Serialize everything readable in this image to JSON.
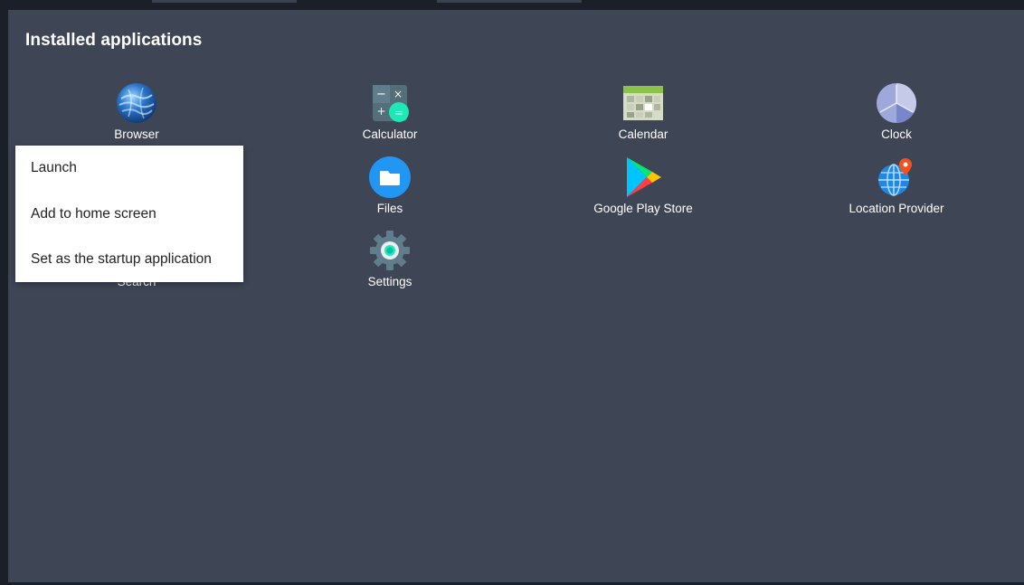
{
  "header": {
    "title": "Installed applications"
  },
  "apps": [
    {
      "label": "Browser",
      "icon": "browser-globe-icon"
    },
    {
      "label": "Calculator",
      "icon": "calculator-icon"
    },
    {
      "label": "Calendar",
      "icon": "calendar-icon"
    },
    {
      "label": "Clock",
      "icon": "clock-icon"
    },
    {
      "label": "Files",
      "icon": "folder-icon"
    },
    {
      "label": "Google Play Store",
      "icon": "play-store-icon"
    },
    {
      "label": "Location Provider",
      "icon": "location-globe-icon"
    },
    {
      "label": "Search",
      "icon": "search-icon"
    },
    {
      "label": "Settings",
      "icon": "gear-icon"
    }
  ],
  "context_menu": {
    "items": [
      {
        "label": "Launch"
      },
      {
        "label": "Add to home screen"
      },
      {
        "label": "Set as the startup application"
      }
    ]
  },
  "colors": {
    "screen_background": "#3e4555",
    "frame": "#1b1f28",
    "menu_background": "#ffffff",
    "files_blue": "#2196f3",
    "calculator_green": "#1de9b6"
  }
}
